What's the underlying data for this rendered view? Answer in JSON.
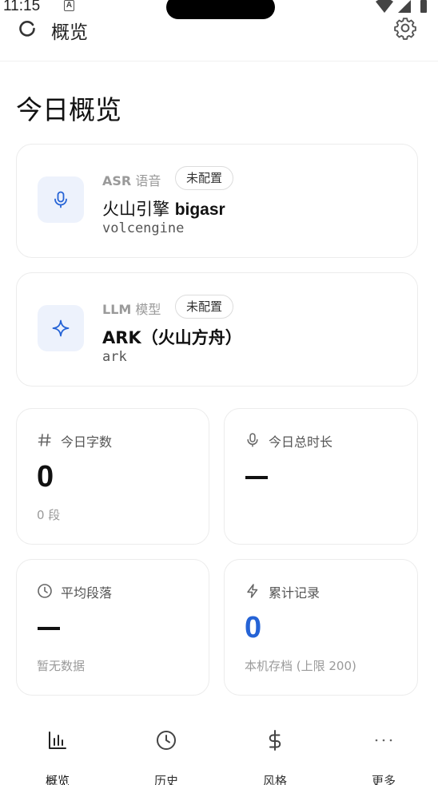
{
  "status_bar": {
    "time": "11:15",
    "notification_glyph": "A"
  },
  "app_bar": {
    "title": "概览",
    "refresh_icon": "refresh-icon",
    "settings_icon": "gear-icon"
  },
  "page": {
    "title": "今日概览"
  },
  "engines": [
    {
      "kind_en": "ASR",
      "kind_zh": "语音",
      "badge": "未配置",
      "name_cn": "火山引擎",
      "name_en": "bigasr",
      "code": "volcengine",
      "icon": "microphone-icon"
    },
    {
      "kind_en": "LLM",
      "kind_zh": "模型",
      "badge": "未配置",
      "name_cn": "ARK（火山方舟）",
      "code": "ark",
      "icon": "sparkle-icon"
    }
  ],
  "stats": {
    "today_chars": {
      "label": "今日字数",
      "value": "0",
      "sub": "0 段",
      "icon": "hash-icon"
    },
    "today_duration": {
      "label": "今日总时长",
      "value": "—",
      "icon": "microphone-icon"
    },
    "avg_paragraph": {
      "label": "平均段落",
      "value": "—",
      "sub": "暂无数据",
      "icon": "clock-icon"
    },
    "total_records": {
      "label": "累计记录",
      "value": "0",
      "sub": "本机存档 (上限 200)",
      "icon": "lightning-icon"
    }
  },
  "nav": [
    {
      "label": "概览",
      "icon": "bar-chart-icon",
      "active": true
    },
    {
      "label": "历史",
      "icon": "clock-icon"
    },
    {
      "label": "风格",
      "icon": "dollar-icon"
    },
    {
      "label": "更多",
      "icon": "more-dots-icon"
    }
  ],
  "colors": {
    "accent": "#2563d6",
    "icon_bg": "#edf2fc",
    "text_muted": "#9a9a9a",
    "card_border": "#ececec"
  }
}
